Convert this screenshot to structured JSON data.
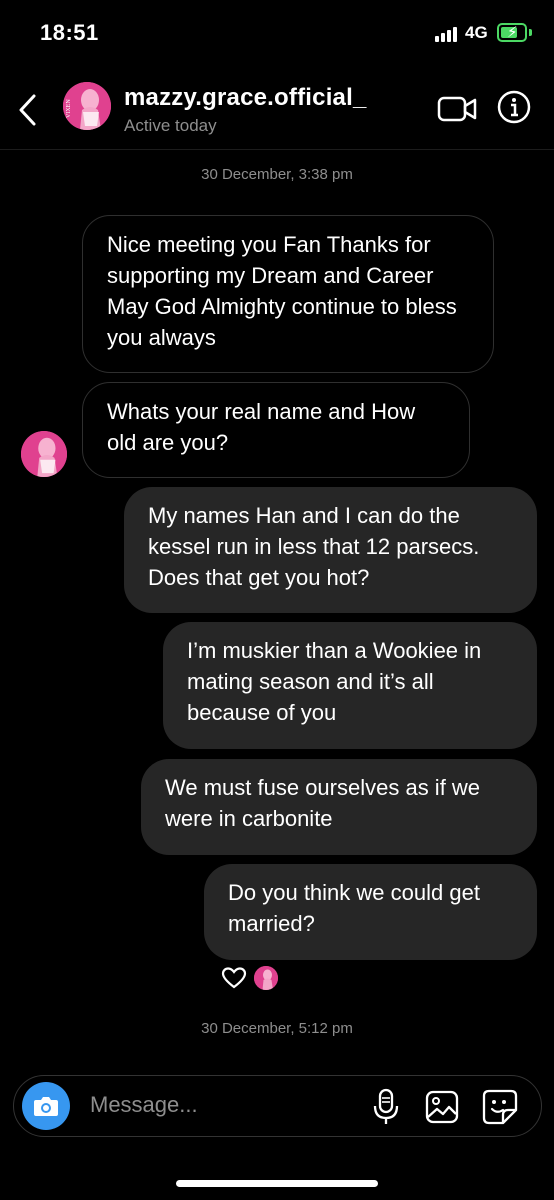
{
  "status": {
    "time": "18:51",
    "network": "4G",
    "battery_color": "#4cd964"
  },
  "header": {
    "username": "mazzy.grace.official_",
    "status": "Active today",
    "avatar_text": "VIXEN"
  },
  "thread": {
    "date1": "30 December, 3:38 pm",
    "messages": [
      {
        "from": "them",
        "text": "Nice meeting you Fan Thanks for supporting my Dream and Career May God Almighty continue to bless you always"
      },
      {
        "from": "them",
        "text": "Whats your real name and How old are you?"
      },
      {
        "from": "me",
        "text": "My names Han and I can do the kessel run in less that 12 parsecs. Does that get you hot?"
      },
      {
        "from": "me",
        "text": "I’m muskier than a Wookiee in mating season and it’s all because of you"
      },
      {
        "from": "me",
        "text": "We must fuse ourselves as if we were in carbonite"
      },
      {
        "from": "me",
        "text": "Do you think we could get married?"
      }
    ],
    "reaction": "heart-icon",
    "date2": "30 December, 5:12 pm"
  },
  "composer": {
    "placeholder": "Message..."
  },
  "colors": {
    "accent": "#3797f0",
    "sent_bubble": "#262626",
    "avatar": "#e0418f"
  }
}
